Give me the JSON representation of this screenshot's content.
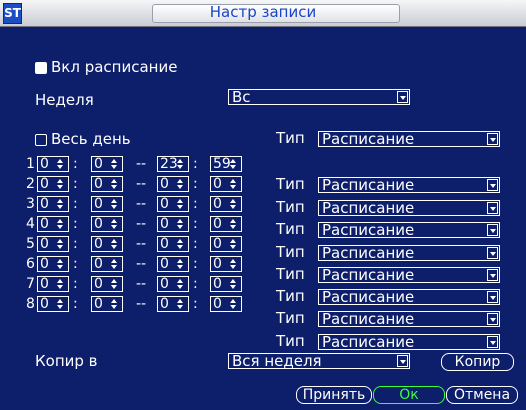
{
  "window": {
    "logo": "ST",
    "title": "Настр записи"
  },
  "schedule": {
    "enable_label": "Вкл расписание",
    "enable_checked": true,
    "week_label": "Неделя",
    "week_value": "Вс",
    "allday_label": "Весь день",
    "allday_checked": false,
    "type_label": "Тип",
    "allday_type": "Расписание",
    "separator_colon": ":",
    "separator_dash": "--",
    "rows": [
      {
        "num": "1",
        "h1": "0",
        "m1": "0",
        "h2": "23",
        "m2": "59",
        "type": "Расписание"
      },
      {
        "num": "2",
        "h1": "0",
        "m1": "0",
        "h2": "0",
        "m2": "0",
        "type": "Расписание"
      },
      {
        "num": "3",
        "h1": "0",
        "m1": "0",
        "h2": "0",
        "m2": "0",
        "type": "Расписание"
      },
      {
        "num": "4",
        "h1": "0",
        "m1": "0",
        "h2": "0",
        "m2": "0",
        "type": "Расписание"
      },
      {
        "num": "5",
        "h1": "0",
        "m1": "0",
        "h2": "0",
        "m2": "0",
        "type": "Расписание"
      },
      {
        "num": "6",
        "h1": "0",
        "m1": "0",
        "h2": "0",
        "m2": "0",
        "type": "Расписание"
      },
      {
        "num": "7",
        "h1": "0",
        "m1": "0",
        "h2": "0",
        "m2": "0",
        "type": "Расписание"
      },
      {
        "num": "8",
        "h1": "0",
        "m1": "0",
        "h2": "0",
        "m2": "0",
        "type": "Расписание"
      }
    ]
  },
  "copy": {
    "label": "Копир в",
    "value": "Вся неделя",
    "button": "Копир"
  },
  "footer": {
    "apply": "Принять",
    "ok": "Ок",
    "cancel": "Отмена"
  },
  "colors": {
    "background": "#0d1e6b",
    "title": "#1a45c8",
    "ok": "#3aff3a"
  }
}
